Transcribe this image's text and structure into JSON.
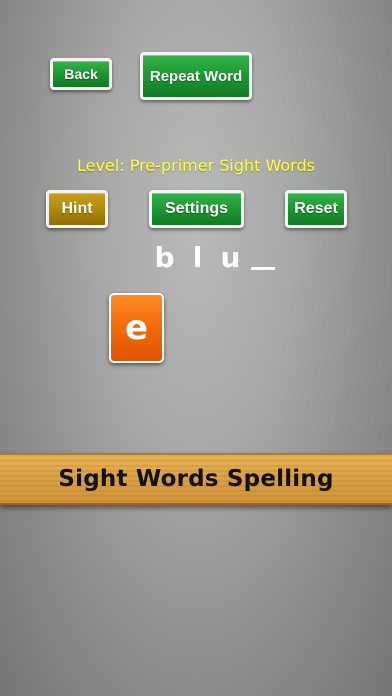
{
  "header": {
    "back_label": "Back",
    "repeat_label": "Repeat Word"
  },
  "level": {
    "text": "Level: Pre-primer Sight Words"
  },
  "controls": {
    "hint_label": "Hint",
    "settings_label": "Settings",
    "reset_label": "Reset"
  },
  "word": {
    "letters": [
      "b",
      "l",
      "u"
    ]
  },
  "tiles": [
    "e"
  ],
  "banner": {
    "title": "Sight Words Spelling"
  },
  "colors": {
    "button_green": "#1f9a34",
    "button_gold": "#b08a0c",
    "level_text": "#ffff33",
    "tile_orange": "#f26a0a",
    "banner_wood": "#dda446"
  }
}
